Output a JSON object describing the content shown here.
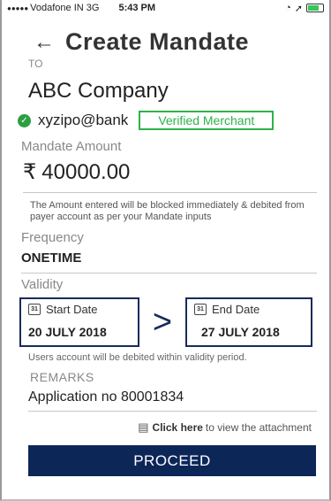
{
  "status_bar": {
    "carrier": "Vodafone IN",
    "network": "3G",
    "time": "5:43 PM"
  },
  "header": {
    "title": "Create Mandate"
  },
  "payee": {
    "to_label": "TO",
    "name": "ABC Company",
    "vpa": "xyzipo@bank",
    "badge": "Verified Merchant"
  },
  "amount": {
    "label": "Mandate Amount",
    "currency_symbol": "₹",
    "value": "40000.00",
    "note": "The Amount entered will be blocked immediately & debited from payer account as per your Mandate inputs"
  },
  "frequency": {
    "label": "Frequency",
    "value": "ONETIME"
  },
  "validity": {
    "label": "Validity",
    "start_label": "Start Date",
    "start_value": "20 JULY 2018",
    "end_label": "End Date",
    "end_value": "27 JULY 2018",
    "separator": ">",
    "calendar_day": "31",
    "note": "Users account will be debited within validity period."
  },
  "remarks": {
    "label": "REMARKS",
    "value": "Application no 80001834"
  },
  "attachment": {
    "link_text": "Click here",
    "rest_text": "to view the attachment"
  },
  "actions": {
    "proceed_label": "PROCEED"
  },
  "colors": {
    "primary": "#0d2658",
    "verified": "#2db34a"
  }
}
